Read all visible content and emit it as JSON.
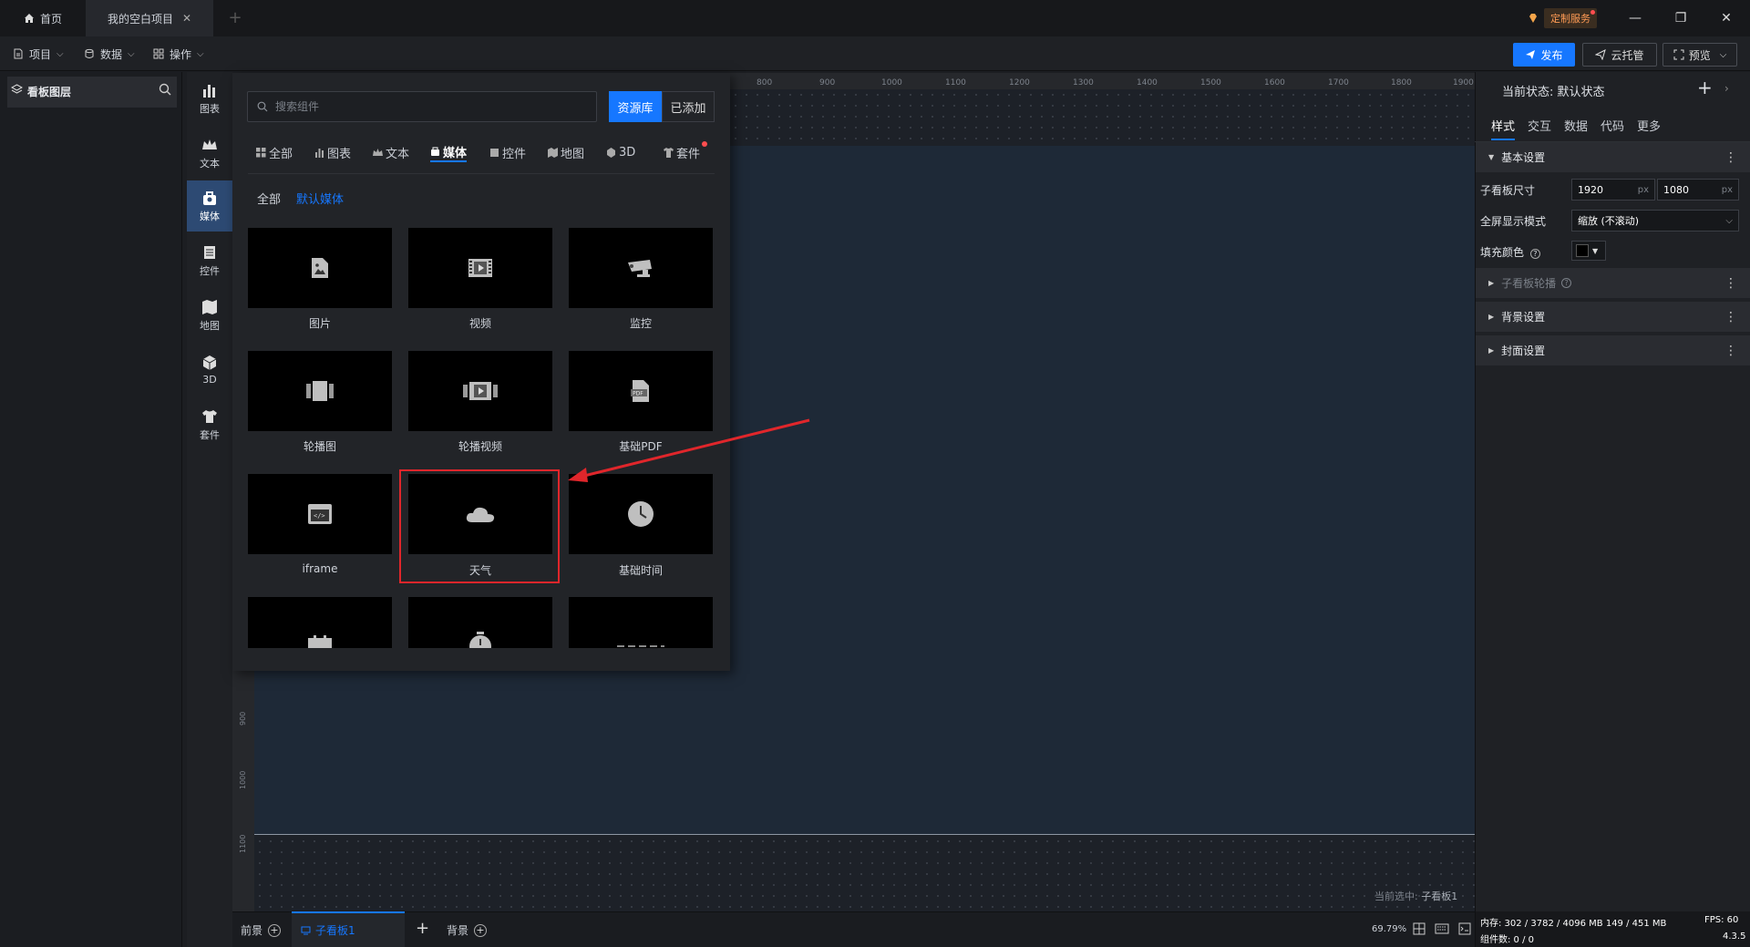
{
  "titlebar": {
    "home_tab": "首页",
    "project_tab": "我的空白项目",
    "custom_service": "定制服务"
  },
  "toolbar": {
    "menus": [
      "项目",
      "数据",
      "操作"
    ],
    "publish": "发布",
    "cloud": "云托管",
    "preview": "预览"
  },
  "layer_panel": {
    "title": "看板图层"
  },
  "categories": [
    "图表",
    "文本",
    "媒体",
    "控件",
    "地图",
    "3D",
    "套件"
  ],
  "popup": {
    "search_placeholder": "搜索组件",
    "library_button": "资源库",
    "added_button": "已添加",
    "tabs": [
      "全部",
      "图表",
      "文本",
      "媒体",
      "控件",
      "地图",
      "3D",
      "套件"
    ],
    "active_tab": "媒体",
    "subtabs": [
      "全部",
      "默认媒体"
    ],
    "tiles": [
      "图片",
      "视频",
      "监控",
      "轮播图",
      "轮播视频",
      "基础PDF",
      "iframe",
      "天气",
      "基础时间"
    ]
  },
  "canvas": {
    "ruler_top": [
      "800",
      "900",
      "1000",
      "1100",
      "1200",
      "1300",
      "1400",
      "1500",
      "1600",
      "1700",
      "1800",
      "1900"
    ],
    "ruler_left": [
      "900",
      "1000",
      "1100"
    ],
    "current_selected_label": "当前选中:",
    "current_selected_value": "子看板1"
  },
  "bottombar": {
    "foreground": "前景",
    "active_board": "子看板1",
    "background": "背景",
    "zoom": "69.79%"
  },
  "right_panel": {
    "state_label": "当前状态:  默认状态",
    "tabs": [
      "样式",
      "交互",
      "数据",
      "代码",
      "更多"
    ],
    "basic_settings": "基本设置",
    "board_size_label": "子看板尺寸",
    "width": "1920",
    "height": "1080",
    "unit": "px",
    "fullscreen_label": "全屏显示模式",
    "fullscreen_value": "缩放 (不滚动)",
    "fill_color_label": "填充颜色",
    "carousel": "子看板轮播",
    "background_settings": "背景设置",
    "cover_settings": "封面设置"
  },
  "footer": {
    "memory": "内存:   302 / 3782 / 4096 MB  149 / 451 MB",
    "components": "组件数: 0 / 0",
    "fps": "FPS:  60",
    "version": "4.3.5"
  },
  "colors": {
    "accent": "#1677ff",
    "highlight": "#e0262b"
  }
}
